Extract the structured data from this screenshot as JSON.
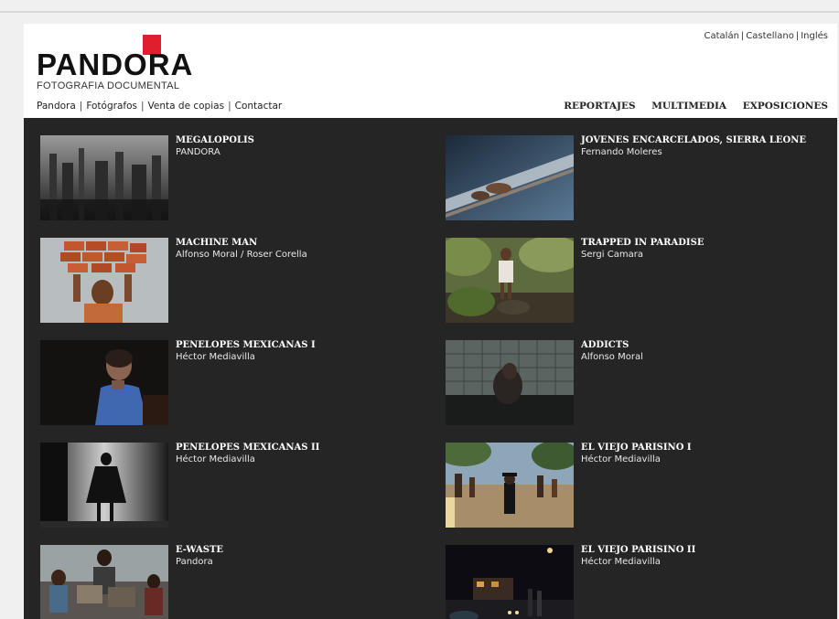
{
  "languages": [
    "Catalán",
    "Castellano",
    "Inglés"
  ],
  "logo": {
    "name": "PANDORA",
    "subtitle": "FOTOGRAFIA DOCUMENTAL"
  },
  "nav": {
    "left": [
      "Pandora",
      "Fotógrafos",
      "Venta de copias",
      "Contactar"
    ],
    "right": [
      "REPORTAJES",
      "MULTIMEDIA",
      "EXPOSICIONES"
    ]
  },
  "reportajes": [
    {
      "title": "MEGALOPOLIS",
      "author": "PANDORA",
      "thumb": "megalopolis-photo"
    },
    {
      "title": "JOVENES ENCARCELADOS, SIERRA LEONE",
      "author": "Fernando Moleres",
      "thumb": "prison-hands-photo"
    },
    {
      "title": "MACHINE MAN",
      "author": "Alfonso Moral / Roser Corella",
      "thumb": "brick-carrier-photo"
    },
    {
      "title": "TRAPPED IN PARADISE",
      "author": "Sergi Camara",
      "thumb": "child-forest-photo"
    },
    {
      "title": "PENELOPES MEXICANAS I",
      "author": "Héctor Mediavilla",
      "thumb": "woman-portrait-photo"
    },
    {
      "title": "ADDICTS",
      "author": "Alfonso Moral",
      "thumb": "addict-photo"
    },
    {
      "title": "PENELOPES MEXICANAS II",
      "author": "Héctor Mediavilla",
      "thumb": "girl-silhouette-photo"
    },
    {
      "title": "EL VIEJO PARISINO I",
      "author": "Héctor Mediavilla",
      "thumb": "street-parade-photo"
    },
    {
      "title": "E-WASTE",
      "author": "Pandora",
      "thumb": "ewaste-photo"
    },
    {
      "title": "EL VIEJO PARISINO II",
      "author": "Héctor Mediavilla",
      "thumb": "night-street-photo"
    }
  ]
}
